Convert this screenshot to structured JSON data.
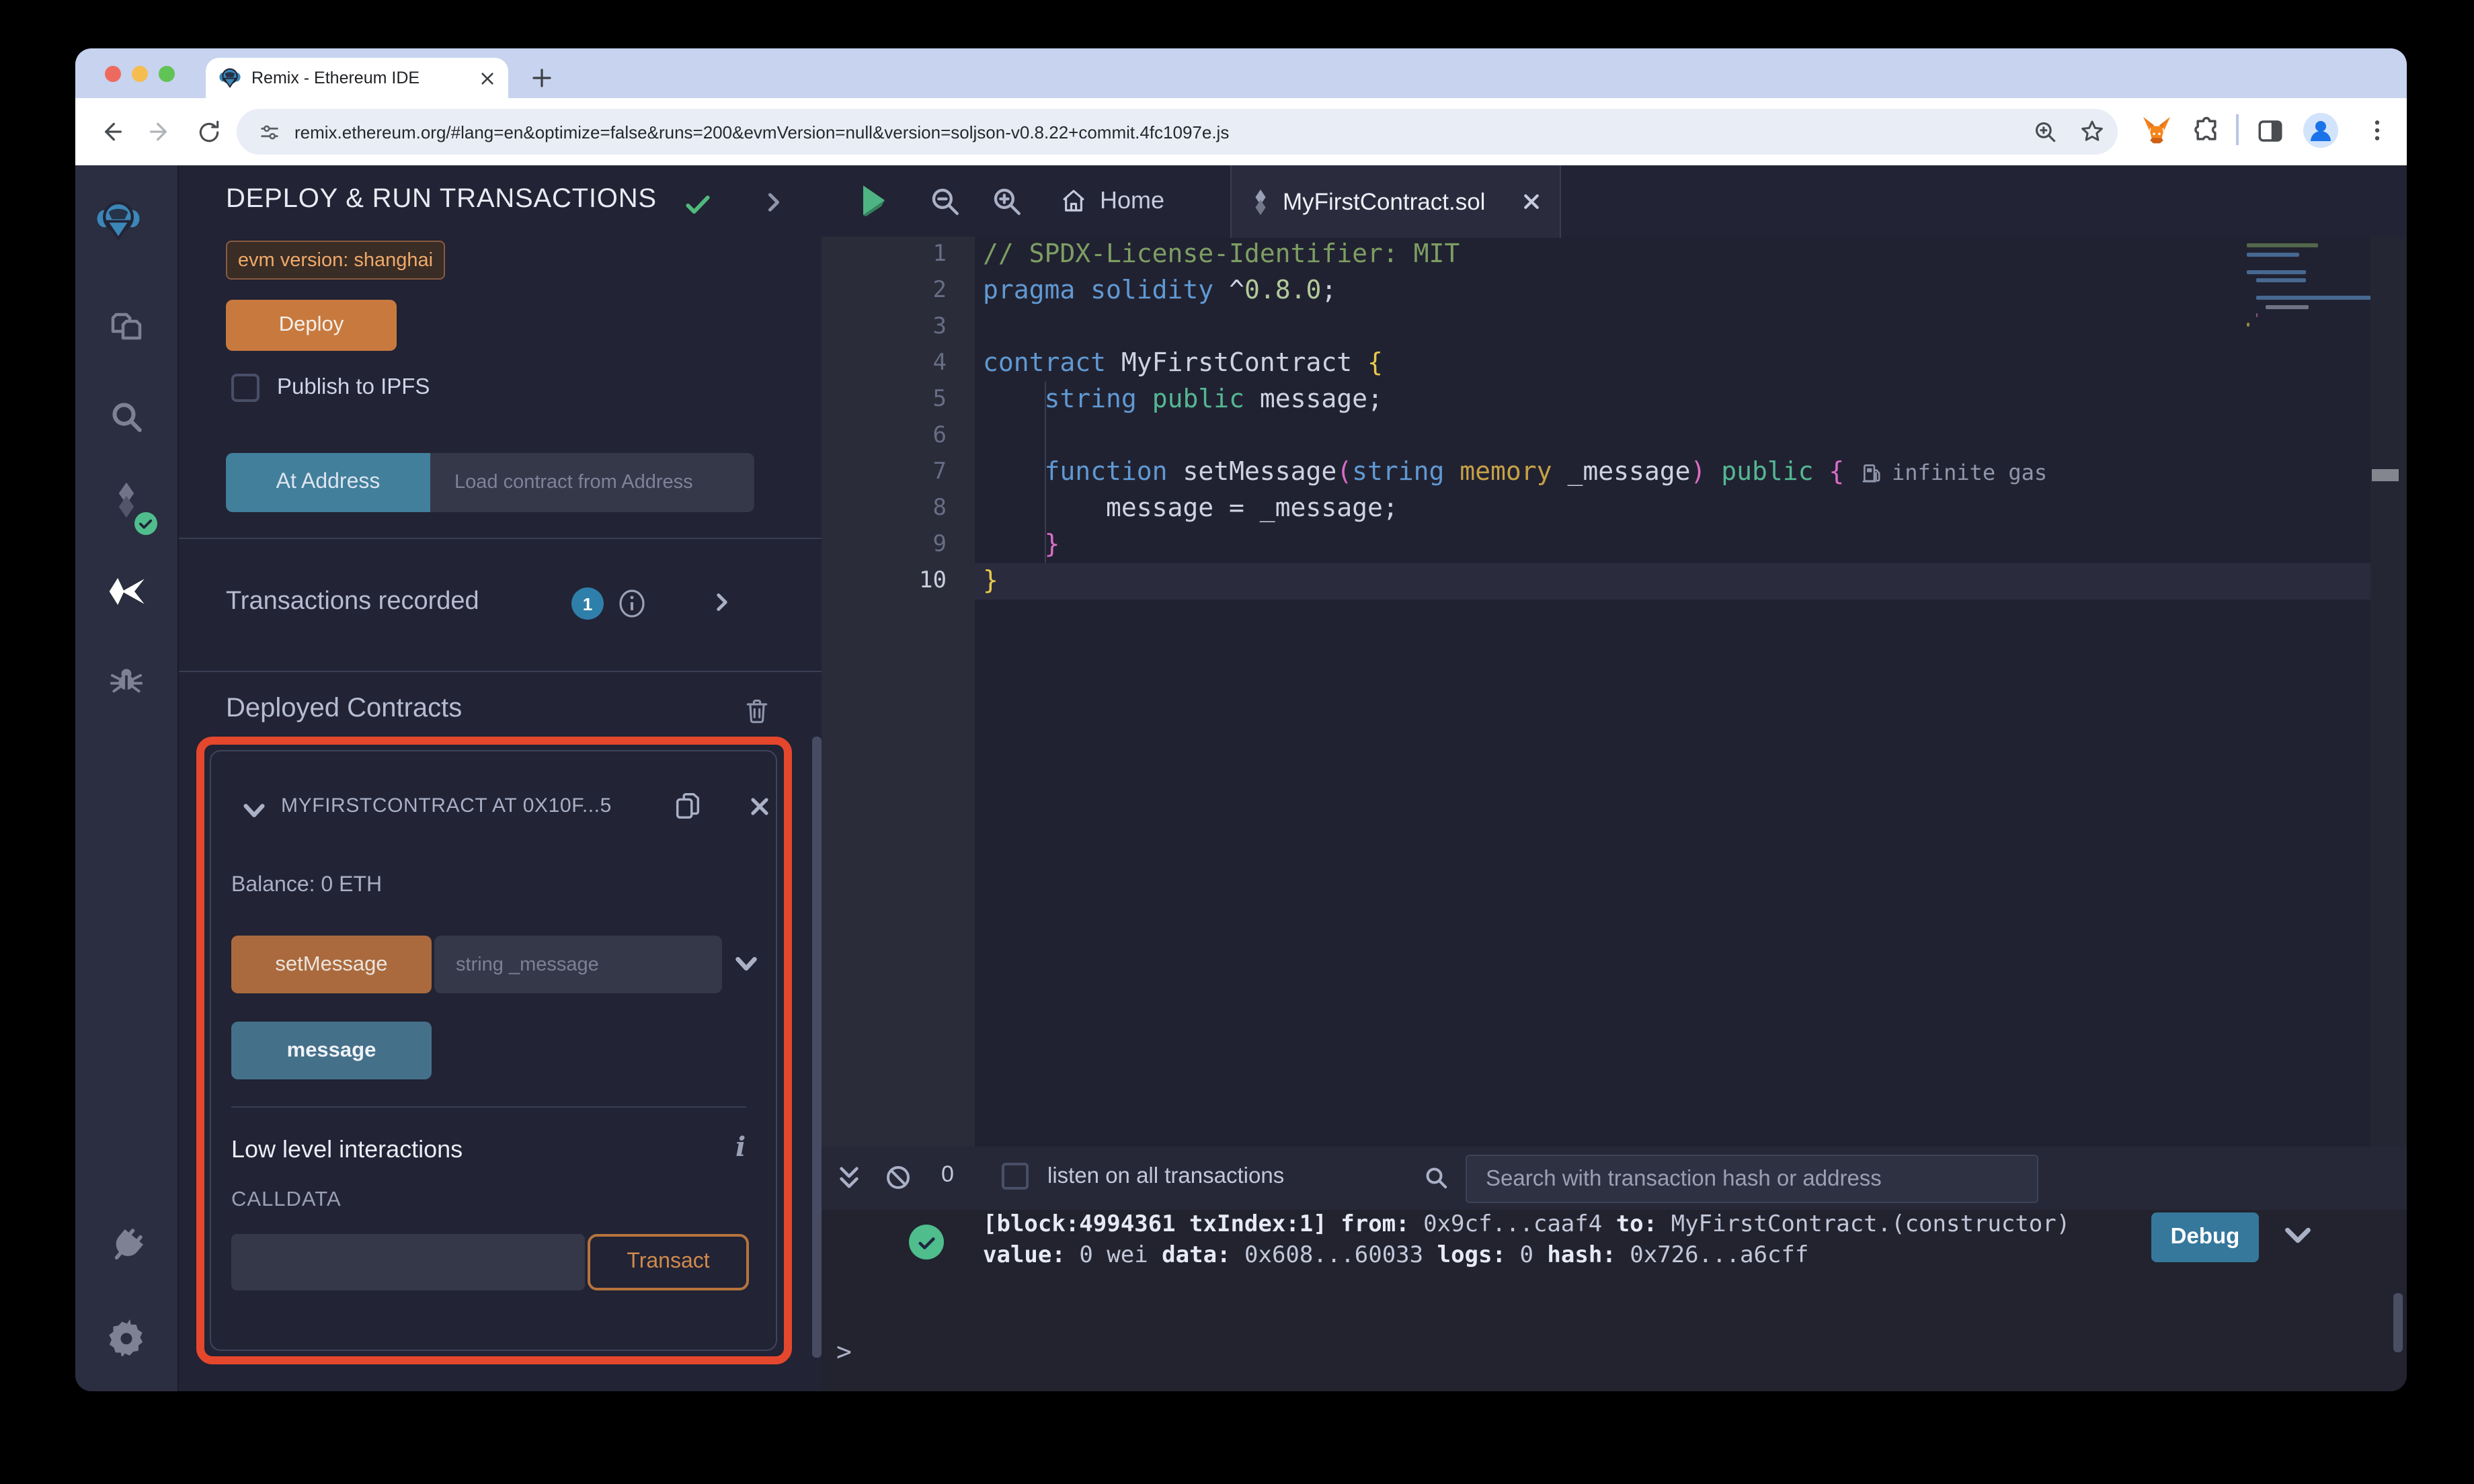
{
  "browser": {
    "tab_title": "Remix - Ethereum IDE",
    "url": "remix.ethereum.org/#lang=en&optimize=false&runs=200&evmVersion=null&version=soljson-v0.8.22+commit.4fc1097e.js"
  },
  "activity_bar": {
    "icons": [
      "remix-logo",
      "file-explorer",
      "search",
      "solidity-compiler",
      "deploy-and-run",
      "debugger",
      "plugin-manager",
      "settings"
    ]
  },
  "deploy_panel": {
    "title": "DEPLOY & RUN TRANSACTIONS",
    "evm_badge": "evm version: shanghai",
    "deploy_button": "Deploy",
    "publish_label": "Publish to IPFS",
    "at_address_button": "At Address",
    "at_address_placeholder": "Load contract from Address",
    "transactions_recorded": "Transactions recorded",
    "transactions_count": "1",
    "deployed_contracts": "Deployed Contracts",
    "contract_card": {
      "title": "MYFIRSTCONTRACT AT 0X10F...5",
      "balance": "Balance: 0 ETH",
      "set_message_button": "setMessage",
      "set_message_placeholder": "string _message",
      "message_button": "message",
      "low_level_title": "Low level interactions",
      "calldata_label": "CALLDATA",
      "transact_button": "Transact"
    }
  },
  "editor": {
    "home_tab": "Home",
    "file_tab": "MyFirstContract.sol",
    "gas_annotation": "infinite gas",
    "lines": [
      {
        "n": "1",
        "tokens": [
          {
            "t": "// SPDX-License-Identifier: MIT",
            "c": "comment"
          }
        ]
      },
      {
        "n": "2",
        "tokens": [
          {
            "t": "pragma solidity ",
            "c": "keyword"
          },
          {
            "t": "^",
            "c": "plain"
          },
          {
            "t": "0.8.0",
            "c": "number"
          },
          {
            "t": ";",
            "c": "plain"
          }
        ]
      },
      {
        "n": "3",
        "tokens": []
      },
      {
        "n": "4",
        "tokens": [
          {
            "t": "contract ",
            "c": "keyword"
          },
          {
            "t": "MyFirstContract ",
            "c": "plain"
          },
          {
            "t": "{",
            "c": "brace-yellow"
          }
        ]
      },
      {
        "n": "5",
        "tokens": [
          {
            "t": "    ",
            "c": "plain"
          },
          {
            "t": "string ",
            "c": "keyword"
          },
          {
            "t": "public ",
            "c": "modifier"
          },
          {
            "t": "message;",
            "c": "plain"
          }
        ]
      },
      {
        "n": "6",
        "tokens": []
      },
      {
        "n": "7",
        "tokens": [
          {
            "t": "    ",
            "c": "plain"
          },
          {
            "t": "function ",
            "c": "keyword"
          },
          {
            "t": "setMessage",
            "c": "plain"
          },
          {
            "t": "(",
            "c": "bracket-pink"
          },
          {
            "t": "string ",
            "c": "keyword"
          },
          {
            "t": "memory ",
            "c": "storage"
          },
          {
            "t": "_message",
            "c": "plain"
          },
          {
            "t": ")",
            "c": "bracket-pink"
          },
          {
            "t": " public ",
            "c": "modifier"
          },
          {
            "t": "{",
            "c": "bracket-pink"
          }
        ]
      },
      {
        "n": "8",
        "tokens": [
          {
            "t": "        message = _message;",
            "c": "plain"
          }
        ]
      },
      {
        "n": "9",
        "tokens": [
          {
            "t": "    ",
            "c": "plain"
          },
          {
            "t": "}",
            "c": "bracket-pink"
          }
        ]
      },
      {
        "n": "10",
        "tokens": [
          {
            "t": "}",
            "c": "brace-yellow"
          }
        ],
        "active": true
      }
    ]
  },
  "terminal": {
    "badge_count": "0",
    "listen_label": "listen on all transactions",
    "search_placeholder": "Search with transaction hash or address",
    "debug_button": "Debug",
    "prompt": ">",
    "log_line1": [
      {
        "t": "[block:4994361 txIndex:1]",
        "b": true
      },
      {
        "t": " ",
        "b": false
      },
      {
        "t": "from:",
        "b": true
      },
      {
        "t": " 0x9cf...caaf4 ",
        "b": false
      },
      {
        "t": "to:",
        "b": true
      },
      {
        "t": " MyFirstContract.(constructor)",
        "b": false
      }
    ],
    "log_line2": [
      {
        "t": "value:",
        "b": true
      },
      {
        "t": " 0 wei ",
        "b": false
      },
      {
        "t": "data:",
        "b": true
      },
      {
        "t": " 0x608...60033 ",
        "b": false
      },
      {
        "t": "logs:",
        "b": true
      },
      {
        "t": " 0 ",
        "b": false
      },
      {
        "t": "hash:",
        "b": true
      },
      {
        "t": " 0x726...a6cff",
        "b": false
      }
    ]
  },
  "colors": {
    "accent_orange": "#c87a3e",
    "accent_teal": "#417f9b",
    "highlight_red": "#e5472d",
    "badge_blue": "#2f7fab",
    "success_green": "#4fbd8c",
    "debug_blue": "#35789c"
  }
}
